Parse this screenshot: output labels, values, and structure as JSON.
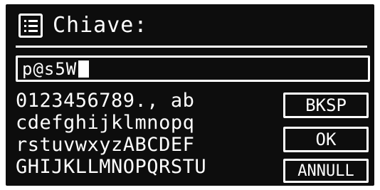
{
  "header": {
    "icon": "list-menu-icon",
    "title": "Chiave:"
  },
  "input": {
    "value": "p@s5W"
  },
  "charset": {
    "rows": [
      "0123456789., ab",
      "cdefghijklmnopq",
      "rstuvwxyzABCDEF",
      "GHIJKLLMNOPQRSTU"
    ]
  },
  "buttons": {
    "bksp": "BKSP",
    "ok": "OK",
    "annull": "ANNULL"
  },
  "colors": {
    "screen_background": "#0d0d0d",
    "foreground": "#ffffff"
  }
}
